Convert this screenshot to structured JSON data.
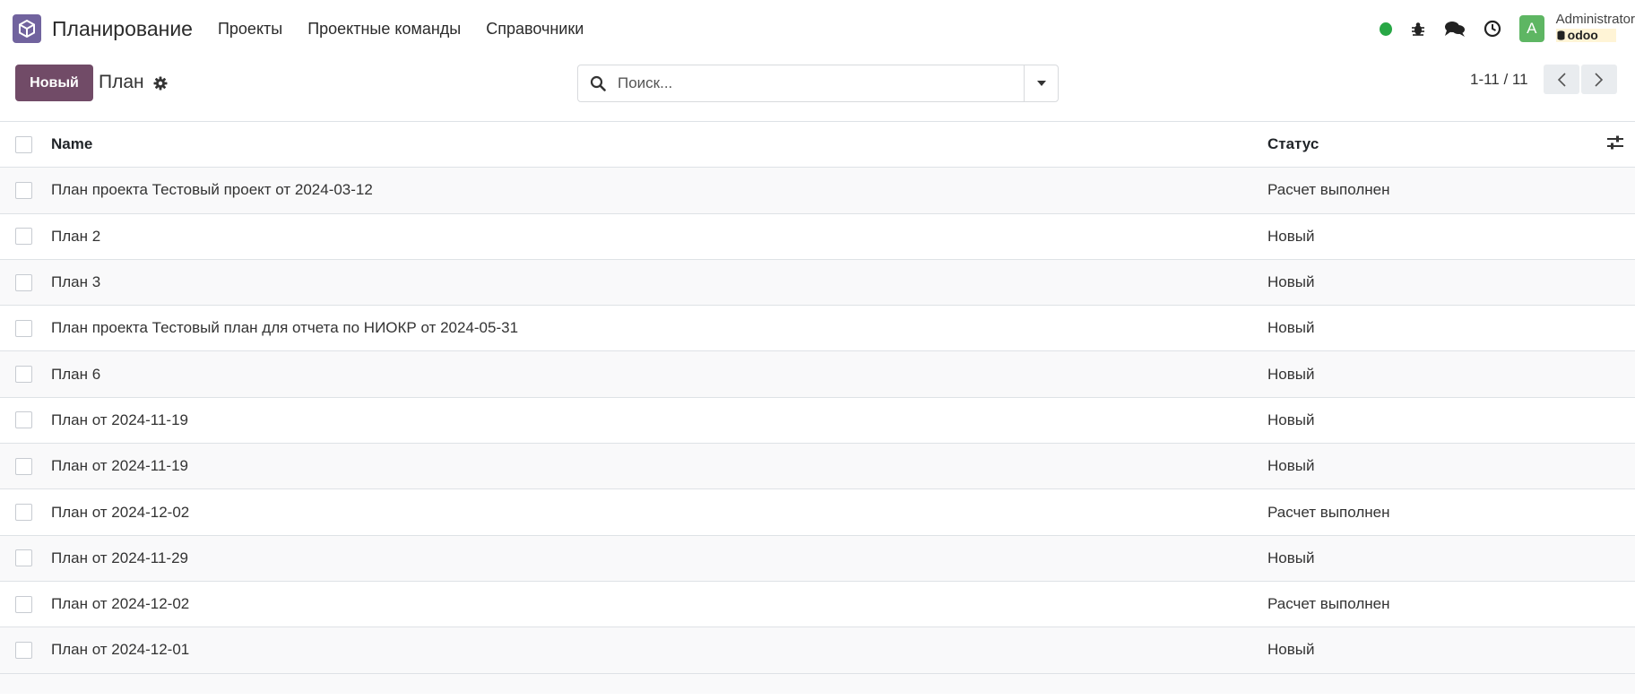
{
  "navbar": {
    "app_title": "Планирование",
    "menu": [
      "Проекты",
      "Проектные команды",
      "Справочники"
    ],
    "user_name": "Administrator",
    "db_name": "odoo",
    "avatar_letter": "A",
    "colors": {
      "presence": "#28a745",
      "avatar": "#5eb663",
      "app_icon": "#71639e"
    }
  },
  "control_panel": {
    "new_button_label": "Новый",
    "breadcrumb": "План",
    "search_placeholder": "Поиск...",
    "pager": "1-11 / 11",
    "colors": {
      "primary": "#714b67"
    }
  },
  "list": {
    "columns": [
      "Name",
      "Статус"
    ],
    "rows": [
      {
        "name": "План проекта Тестовый проект от 2024-03-12",
        "status": "Расчет выполнен"
      },
      {
        "name": "План 2",
        "status": "Новый"
      },
      {
        "name": "План 3",
        "status": "Новый"
      },
      {
        "name": "План проекта Тестовый план для отчета по НИОКР от 2024-05-31",
        "status": "Новый"
      },
      {
        "name": "План 6",
        "status": "Новый"
      },
      {
        "name": "План от 2024-11-19",
        "status": "Новый"
      },
      {
        "name": "План от 2024-11-19",
        "status": "Новый"
      },
      {
        "name": "План от 2024-12-02",
        "status": "Расчет выполнен"
      },
      {
        "name": "План от 2024-11-29",
        "status": "Новый"
      },
      {
        "name": "План от 2024-12-02",
        "status": "Расчет выполнен"
      },
      {
        "name": "План от 2024-12-01",
        "status": "Новый"
      }
    ]
  }
}
